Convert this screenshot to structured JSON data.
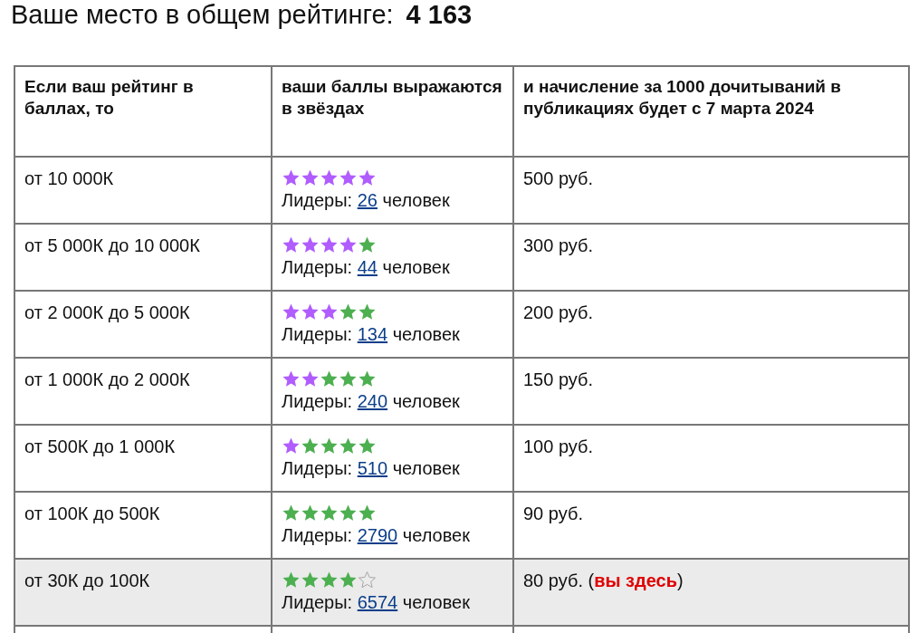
{
  "heading": {
    "label": "Ваше место в общем рейтинге:",
    "value": "4 163"
  },
  "table": {
    "columns": [
      "Если ваш рейтинг в баллах, то",
      "ваши баллы выражаются в звёздах",
      "и начисление за 1000 дочитываний в публикациях будет с 7 марта 2024"
    ],
    "rows": [
      {
        "range": "от 10 000К",
        "star_icons": [
          {
            "kind": "purple"
          },
          {
            "kind": "purple"
          },
          {
            "kind": "purple"
          },
          {
            "kind": "purple"
          },
          {
            "kind": "purple"
          }
        ],
        "leaders_label": "Лидеры:",
        "leaders_count": "26",
        "leaders_suffix": "человек",
        "reward": "500 руб.",
        "selected": false
      },
      {
        "range": "от 5 000К до 10 000К",
        "star_icons": [
          {
            "kind": "purple"
          },
          {
            "kind": "purple"
          },
          {
            "kind": "purple"
          },
          {
            "kind": "purple"
          },
          {
            "kind": "green"
          }
        ],
        "leaders_label": "Лидеры:",
        "leaders_count": "44",
        "leaders_suffix": "человек",
        "reward": "300 руб.",
        "selected": false
      },
      {
        "range": "от 2 000К до 5 000К",
        "star_icons": [
          {
            "kind": "purple"
          },
          {
            "kind": "purple"
          },
          {
            "kind": "purple"
          },
          {
            "kind": "green"
          },
          {
            "kind": "green"
          }
        ],
        "leaders_label": "Лидеры:",
        "leaders_count": "134",
        "leaders_suffix": "человек",
        "reward": "200 руб.",
        "selected": false
      },
      {
        "range": "от 1 000К до 2 000К",
        "star_icons": [
          {
            "kind": "purple"
          },
          {
            "kind": "purple"
          },
          {
            "kind": "green"
          },
          {
            "kind": "green"
          },
          {
            "kind": "green"
          }
        ],
        "leaders_label": "Лидеры:",
        "leaders_count": "240",
        "leaders_suffix": "человек",
        "reward": "150 руб.",
        "selected": false
      },
      {
        "range": "от 500К до 1 000К",
        "star_icons": [
          {
            "kind": "purple"
          },
          {
            "kind": "green"
          },
          {
            "kind": "green"
          },
          {
            "kind": "green"
          },
          {
            "kind": "green"
          }
        ],
        "leaders_label": "Лидеры:",
        "leaders_count": "510",
        "leaders_suffix": "человек",
        "reward": "100 руб.",
        "selected": false
      },
      {
        "range": "от 100К до 500К",
        "star_icons": [
          {
            "kind": "green"
          },
          {
            "kind": "green"
          },
          {
            "kind": "green"
          },
          {
            "kind": "green"
          },
          {
            "kind": "green"
          }
        ],
        "leaders_label": "Лидеры:",
        "leaders_count": "2790",
        "leaders_suffix": "человек",
        "reward": "90 руб.",
        "selected": false
      },
      {
        "range": "от 30К до 100К",
        "star_icons": [
          {
            "kind": "green"
          },
          {
            "kind": "green"
          },
          {
            "kind": "green"
          },
          {
            "kind": "green"
          },
          {
            "kind": "empty"
          }
        ],
        "leaders_label": "Лидеры:",
        "leaders_count": "6574",
        "leaders_suffix": "человек",
        "reward": "80 руб. (**вы здесь**)",
        "selected": true
      }
    ]
  }
}
